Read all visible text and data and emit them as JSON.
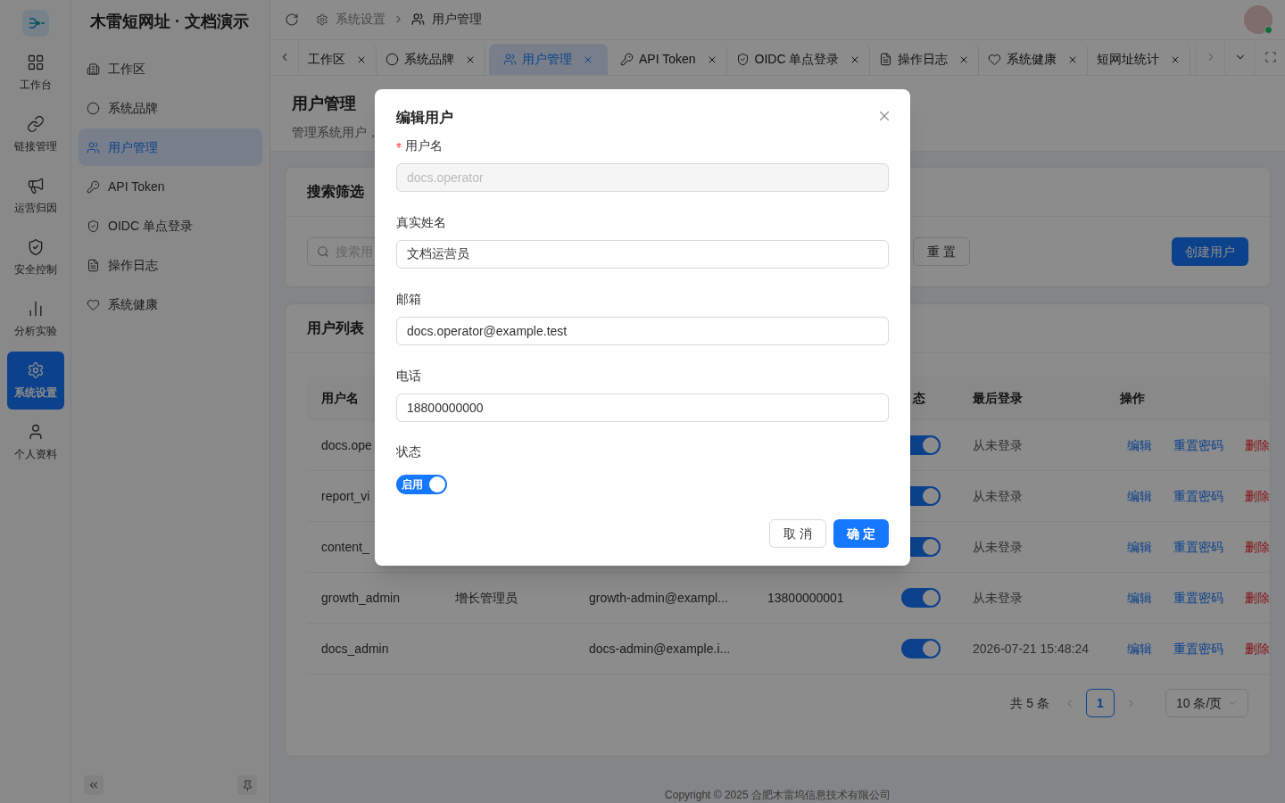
{
  "rail": {
    "items": [
      {
        "label": "工作台",
        "selected": false
      },
      {
        "label": "链接管理",
        "selected": false
      },
      {
        "label": "运营归因",
        "selected": false
      },
      {
        "label": "安全控制",
        "selected": false
      },
      {
        "label": "分析实验",
        "selected": false
      },
      {
        "label": "系统设置",
        "selected": true
      },
      {
        "label": "个人资料",
        "selected": false
      }
    ]
  },
  "sidebar": {
    "title": "木雷短网址 · 文档演示",
    "items": [
      {
        "label": "工作区",
        "selected": false
      },
      {
        "label": "系统品牌",
        "selected": false
      },
      {
        "label": "用户管理",
        "selected": true
      },
      {
        "label": "API Token",
        "selected": false
      },
      {
        "label": "OIDC 单点登录",
        "selected": false
      },
      {
        "label": "操作日志",
        "selected": false
      },
      {
        "label": "系统健康",
        "selected": false
      }
    ]
  },
  "header": {
    "breadcrumb": [
      "系统设置",
      "用户管理"
    ]
  },
  "tabs": [
    {
      "label": "工作区",
      "selected": false
    },
    {
      "label": "系统品牌",
      "selected": false
    },
    {
      "label": "用户管理",
      "selected": true
    },
    {
      "label": "API Token",
      "selected": false
    },
    {
      "label": "OIDC 单点登录",
      "selected": false
    },
    {
      "label": "操作日志",
      "selected": false
    },
    {
      "label": "系统健康",
      "selected": false
    },
    {
      "label": "短网址统计",
      "selected": false
    }
  ],
  "page": {
    "title": "用户管理",
    "subtitle": "管理系统用户，"
  },
  "search_card": {
    "title": "搜索筛选",
    "search": {
      "placeholder": "搜索用"
    },
    "buttons": [
      {
        "label": "重 置",
        "kind": "default"
      },
      {
        "label": "创建用户",
        "kind": "primary"
      }
    ]
  },
  "list_card": {
    "title": "用户列表",
    "columns": [
      {
        "label": "用户名"
      },
      {},
      {},
      {},
      {
        "label": "态"
      },
      {
        "label": "最后登录"
      },
      {
        "label": "操作"
      }
    ],
    "rows": [
      {
        "username": "docs.ope",
        "enabled": true,
        "last_login": "从未登录",
        "actions": [
          {
            "label": "编辑",
            "kind": "link"
          },
          {
            "label": "重置密码",
            "kind": "link"
          },
          {
            "label": "删除",
            "kind": "danger"
          }
        ]
      },
      {
        "username": "report_vi",
        "enabled": true,
        "last_login": "从未登录",
        "actions": [
          {
            "label": "编辑",
            "kind": "link"
          },
          {
            "label": "重置密码",
            "kind": "link"
          },
          {
            "label": "删除",
            "kind": "danger"
          }
        ]
      },
      {
        "username": "content_",
        "enabled": true,
        "last_login": "从未登录",
        "actions": [
          {
            "label": "编辑",
            "kind": "link"
          },
          {
            "label": "重置密码",
            "kind": "link"
          },
          {
            "label": "删除",
            "kind": "danger"
          }
        ]
      },
      {
        "username": "growth_admin",
        "real_name": "增长管理员",
        "email": "growth-admin@exampl...",
        "phone": "13800000001",
        "enabled": true,
        "last_login": "从未登录",
        "actions": [
          {
            "label": "编辑",
            "kind": "link"
          },
          {
            "label": "重置密码",
            "kind": "link"
          },
          {
            "label": "删除",
            "kind": "danger"
          }
        ]
      },
      {
        "username": "docs_admin",
        "email": "docs-admin@example.i...",
        "enabled": true,
        "last_login": "2026-07-21 15:48:24",
        "actions": [
          {
            "label": "编辑",
            "kind": "link"
          },
          {
            "label": "重置密码",
            "kind": "link"
          },
          {
            "label": "删除",
            "kind": "danger"
          }
        ]
      }
    ],
    "pagination": {
      "total": "共 5 条",
      "pages": [
        {
          "label": "1",
          "selected": true
        }
      ],
      "page_size": "10 条/页"
    }
  },
  "footer": "Copyright © 2025 合肥木雷坞信息技术有限公司",
  "dialog": {
    "title": "编辑用户",
    "fields": [
      {
        "label": "用户名",
        "required": true,
        "disabled": true,
        "value": "docs.operator"
      },
      {
        "label": "真实姓名",
        "required": false,
        "disabled": false,
        "value": "文档运营员"
      },
      {
        "label": "邮箱",
        "required": false,
        "disabled": false,
        "value": "docs.operator@example.test"
      },
      {
        "label": "电话",
        "required": false,
        "disabled": false,
        "value": "18800000000"
      }
    ],
    "status": {
      "label": "状态",
      "on": true,
      "text": "启用"
    },
    "buttons": [
      {
        "label": "取 消",
        "kind": "default"
      },
      {
        "label": "确 定",
        "kind": "primary"
      }
    ]
  }
}
